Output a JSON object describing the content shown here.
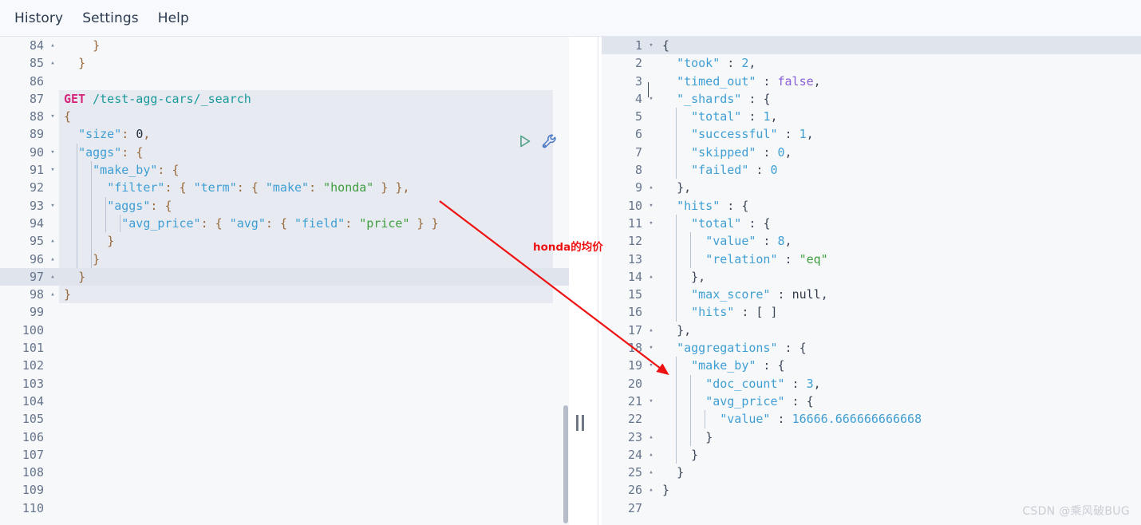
{
  "menubar": {
    "items": [
      {
        "label": "History",
        "name": "menu-history"
      },
      {
        "label": "Settings",
        "name": "menu-settings"
      },
      {
        "label": "Help",
        "name": "menu-help"
      }
    ]
  },
  "annotation": {
    "text": "honda的均价",
    "color": "#ee1111"
  },
  "watermark": {
    "text": "CSDN @乘风破BUG"
  },
  "icons": {
    "play": {
      "name": "play-icon",
      "color": "#4f9e87",
      "title": "Click to send request"
    },
    "wrench": {
      "name": "wrench-icon",
      "color": "#4e79c4",
      "title": "Open documentation / actions"
    }
  },
  "colors": {
    "method": "#d6267b",
    "url": "#1a9a9a",
    "key": "#3f9fd4",
    "string": "#3f9f3f",
    "punct": "#98693a",
    "boolean": "#8a5fd6",
    "active_line": "#dfe4ed",
    "block_bg": "#e7eaf1",
    "editor_bg": "#f7f8fa"
  },
  "request_editor": {
    "name": "request-editor",
    "first_line": 84,
    "last_line": 110,
    "active_line": 97,
    "selected_block": {
      "from": 87,
      "to": 98
    },
    "lines": [
      {
        "n": 84,
        "fold": "close",
        "text": "    }"
      },
      {
        "n": 85,
        "fold": "close",
        "text": "  }"
      },
      {
        "n": 86,
        "fold": "",
        "text": ""
      },
      {
        "n": 87,
        "fold": "",
        "text": "GET /test-agg-cars/_search"
      },
      {
        "n": 88,
        "fold": "open",
        "text": "{"
      },
      {
        "n": 89,
        "fold": "",
        "text": "  \"size\": 0,"
      },
      {
        "n": 90,
        "fold": "open",
        "text": "  \"aggs\": {"
      },
      {
        "n": 91,
        "fold": "open",
        "text": "    \"make_by\": {"
      },
      {
        "n": 92,
        "fold": "",
        "text": "      \"filter\": { \"term\": { \"make\": \"honda\" } },"
      },
      {
        "n": 93,
        "fold": "open",
        "text": "      \"aggs\": {"
      },
      {
        "n": 94,
        "fold": "",
        "text": "        \"avg_price\": { \"avg\": { \"field\": \"price\" } }"
      },
      {
        "n": 95,
        "fold": "close",
        "text": "      }"
      },
      {
        "n": 96,
        "fold": "close",
        "text": "    }"
      },
      {
        "n": 97,
        "fold": "close",
        "text": "  }"
      },
      {
        "n": 98,
        "fold": "close",
        "text": "}"
      },
      {
        "n": 99,
        "fold": "",
        "text": ""
      },
      {
        "n": 100,
        "fold": "",
        "text": ""
      },
      {
        "n": 101,
        "fold": "",
        "text": ""
      },
      {
        "n": 102,
        "fold": "",
        "text": ""
      },
      {
        "n": 103,
        "fold": "",
        "text": ""
      },
      {
        "n": 104,
        "fold": "",
        "text": ""
      },
      {
        "n": 105,
        "fold": "",
        "text": ""
      },
      {
        "n": 106,
        "fold": "",
        "text": ""
      },
      {
        "n": 107,
        "fold": "",
        "text": ""
      },
      {
        "n": 108,
        "fold": "",
        "text": ""
      },
      {
        "n": 109,
        "fold": "",
        "text": ""
      },
      {
        "n": 110,
        "fold": "",
        "text": ""
      }
    ],
    "request": {
      "method": "GET",
      "path": "/test-agg-cars/_search",
      "body": {
        "size": 0,
        "aggs": {
          "make_by": {
            "filter": {
              "term": {
                "make": "honda"
              }
            },
            "aggs": {
              "avg_price": {
                "avg": {
                  "field": "price"
                }
              }
            }
          }
        }
      }
    }
  },
  "response_editor": {
    "name": "response-editor",
    "first_line": 1,
    "last_line": 27,
    "active_line": 1,
    "lines": [
      {
        "n": 1,
        "fold": "open",
        "text": "{"
      },
      {
        "n": 2,
        "fold": "",
        "text": "  \"took\" : 2,"
      },
      {
        "n": 3,
        "fold": "",
        "text": "  \"timed_out\" : false,"
      },
      {
        "n": 4,
        "fold": "open",
        "text": "  \"_shards\" : {"
      },
      {
        "n": 5,
        "fold": "",
        "text": "    \"total\" : 1,"
      },
      {
        "n": 6,
        "fold": "",
        "text": "    \"successful\" : 1,"
      },
      {
        "n": 7,
        "fold": "",
        "text": "    \"skipped\" : 0,"
      },
      {
        "n": 8,
        "fold": "",
        "text": "    \"failed\" : 0"
      },
      {
        "n": 9,
        "fold": "close",
        "text": "  },"
      },
      {
        "n": 10,
        "fold": "open",
        "text": "  \"hits\" : {"
      },
      {
        "n": 11,
        "fold": "open",
        "text": "    \"total\" : {"
      },
      {
        "n": 12,
        "fold": "",
        "text": "      \"value\" : 8,"
      },
      {
        "n": 13,
        "fold": "",
        "text": "      \"relation\" : \"eq\""
      },
      {
        "n": 14,
        "fold": "close",
        "text": "    },"
      },
      {
        "n": 15,
        "fold": "",
        "text": "    \"max_score\" : null,"
      },
      {
        "n": 16,
        "fold": "",
        "text": "    \"hits\" : [ ]"
      },
      {
        "n": 17,
        "fold": "close",
        "text": "  },"
      },
      {
        "n": 18,
        "fold": "open",
        "text": "  \"aggregations\" : {"
      },
      {
        "n": 19,
        "fold": "open",
        "text": "    \"make_by\" : {"
      },
      {
        "n": 20,
        "fold": "",
        "text": "      \"doc_count\" : 3,"
      },
      {
        "n": 21,
        "fold": "open",
        "text": "      \"avg_price\" : {"
      },
      {
        "n": 22,
        "fold": "",
        "text": "        \"value\" : 16666.666666666668"
      },
      {
        "n": 23,
        "fold": "close",
        "text": "      }"
      },
      {
        "n": 24,
        "fold": "close",
        "text": "    }"
      },
      {
        "n": 25,
        "fold": "close",
        "text": "  }"
      },
      {
        "n": 26,
        "fold": "close",
        "text": "}"
      },
      {
        "n": 27,
        "fold": "",
        "text": ""
      }
    ],
    "response": {
      "took": 2,
      "timed_out": false,
      "_shards": {
        "total": 1,
        "successful": 1,
        "skipped": 0,
        "failed": 0
      },
      "hits": {
        "total": {
          "value": 8,
          "relation": "eq"
        },
        "max_score": null,
        "hits": []
      },
      "aggregations": {
        "make_by": {
          "doc_count": 3,
          "avg_price": {
            "value": 16666.666666666668
          }
        }
      }
    }
  }
}
